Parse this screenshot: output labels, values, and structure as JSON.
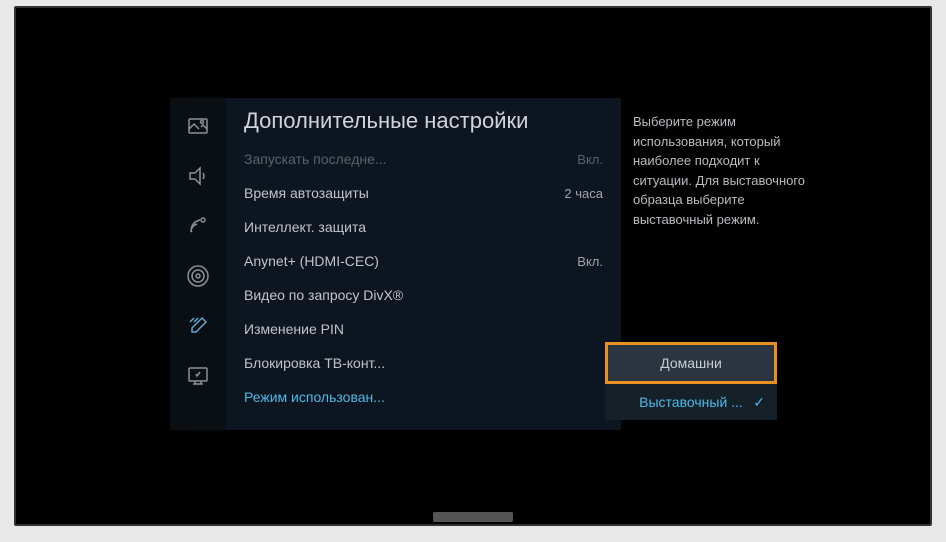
{
  "panel": {
    "title": "Дополнительные настройки"
  },
  "menu": {
    "items": [
      {
        "label": "Запускать последне...",
        "value": "Вкл.",
        "dimmed": true
      },
      {
        "label": "Время автозащиты",
        "value": "2 часа"
      },
      {
        "label": "Интеллект. защита",
        "value": ""
      },
      {
        "label": "Anynet+ (HDMI-CEC)",
        "value": "Вкл."
      },
      {
        "label": "Видео по запросу DivX®",
        "value": ""
      },
      {
        "label": "Изменение PIN",
        "value": ""
      },
      {
        "label": "Блокировка ТВ-конт...",
        "value": ""
      },
      {
        "label": "Режим использован...",
        "value": "",
        "highlighted": true
      }
    ]
  },
  "popup": {
    "option_home": "Домашни",
    "option_retail": "Выставочный ..."
  },
  "help": {
    "text": "Выберите режим использования, который наиболее подходит к ситуации. Для выставочного образца выберите выставочный режим."
  }
}
